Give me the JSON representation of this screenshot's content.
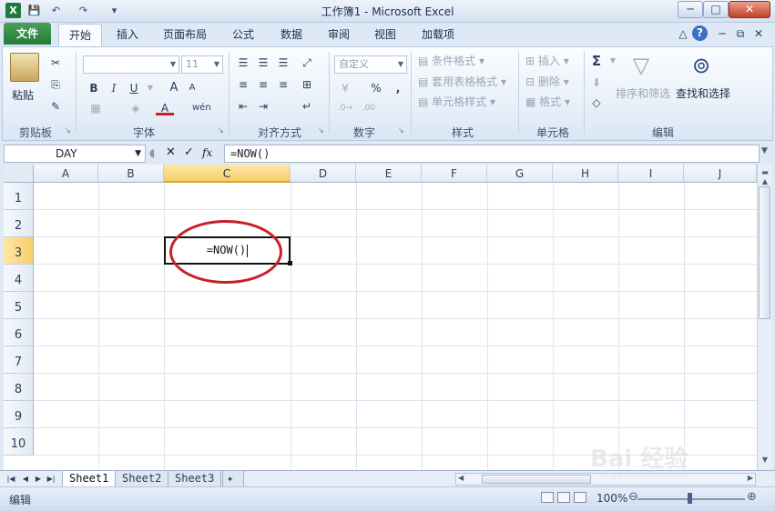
{
  "window": {
    "title": "工作簿1 - Microsoft Excel",
    "minimize": "─",
    "maximize": "□",
    "close": "✕"
  },
  "quick_access": {
    "save": "💾",
    "undo": "↶",
    "redo": "↷",
    "customize": "▾"
  },
  "ribbon_tabs": [
    "文件",
    "开始",
    "插入",
    "页面布局",
    "公式",
    "数据",
    "审阅",
    "视图",
    "加载项"
  ],
  "ribbon_right": {
    "minimize_ribbon": "△",
    "help": "?",
    "restore": "⧉",
    "close": "✕"
  },
  "ribbon": {
    "clipboard": {
      "paste": "粘贴",
      "label": "剪贴板"
    },
    "font": {
      "font_name": "",
      "font_size": "11",
      "bold": "B",
      "italic": "I",
      "underline": "U",
      "grow": "A",
      "shrink": "A",
      "color_a": "A",
      "wen": "wén",
      "label": "字体"
    },
    "alignment": {
      "label": "对齐方式"
    },
    "number": {
      "format": "自定义",
      "percent": "%",
      "comma": ",",
      "label": "数字"
    },
    "styles": {
      "conditional": "条件格式",
      "table": "套用表格格式",
      "cell": "单元格样式",
      "label": "样式"
    },
    "cells": {
      "insert": "插入",
      "delete": "删除",
      "format": "格式",
      "label": "单元格"
    },
    "editing": {
      "sum": "Σ",
      "sort": "排序和筛选",
      "find": "查找和选择",
      "label": "编辑"
    }
  },
  "formula_bar": {
    "name_box": "DAY",
    "cancel": "✕",
    "enter": "✓",
    "fx": "fx",
    "formula": "=NOW()"
  },
  "columns": [
    "A",
    "B",
    "C",
    "D",
    "E",
    "F",
    "G",
    "H",
    "I",
    "J"
  ],
  "rows": [
    "1",
    "2",
    "3",
    "4",
    "5",
    "6",
    "7",
    "8",
    "9",
    "10"
  ],
  "active_cell": {
    "content": "=NOW()"
  },
  "sheets": [
    "Sheet1",
    "Sheet2",
    "Sheet3"
  ],
  "status": {
    "mode": "编辑",
    "zoom": "100%"
  },
  "watermark": "Bai 经验",
  "watermark_url": "jingyan.baidu.com"
}
